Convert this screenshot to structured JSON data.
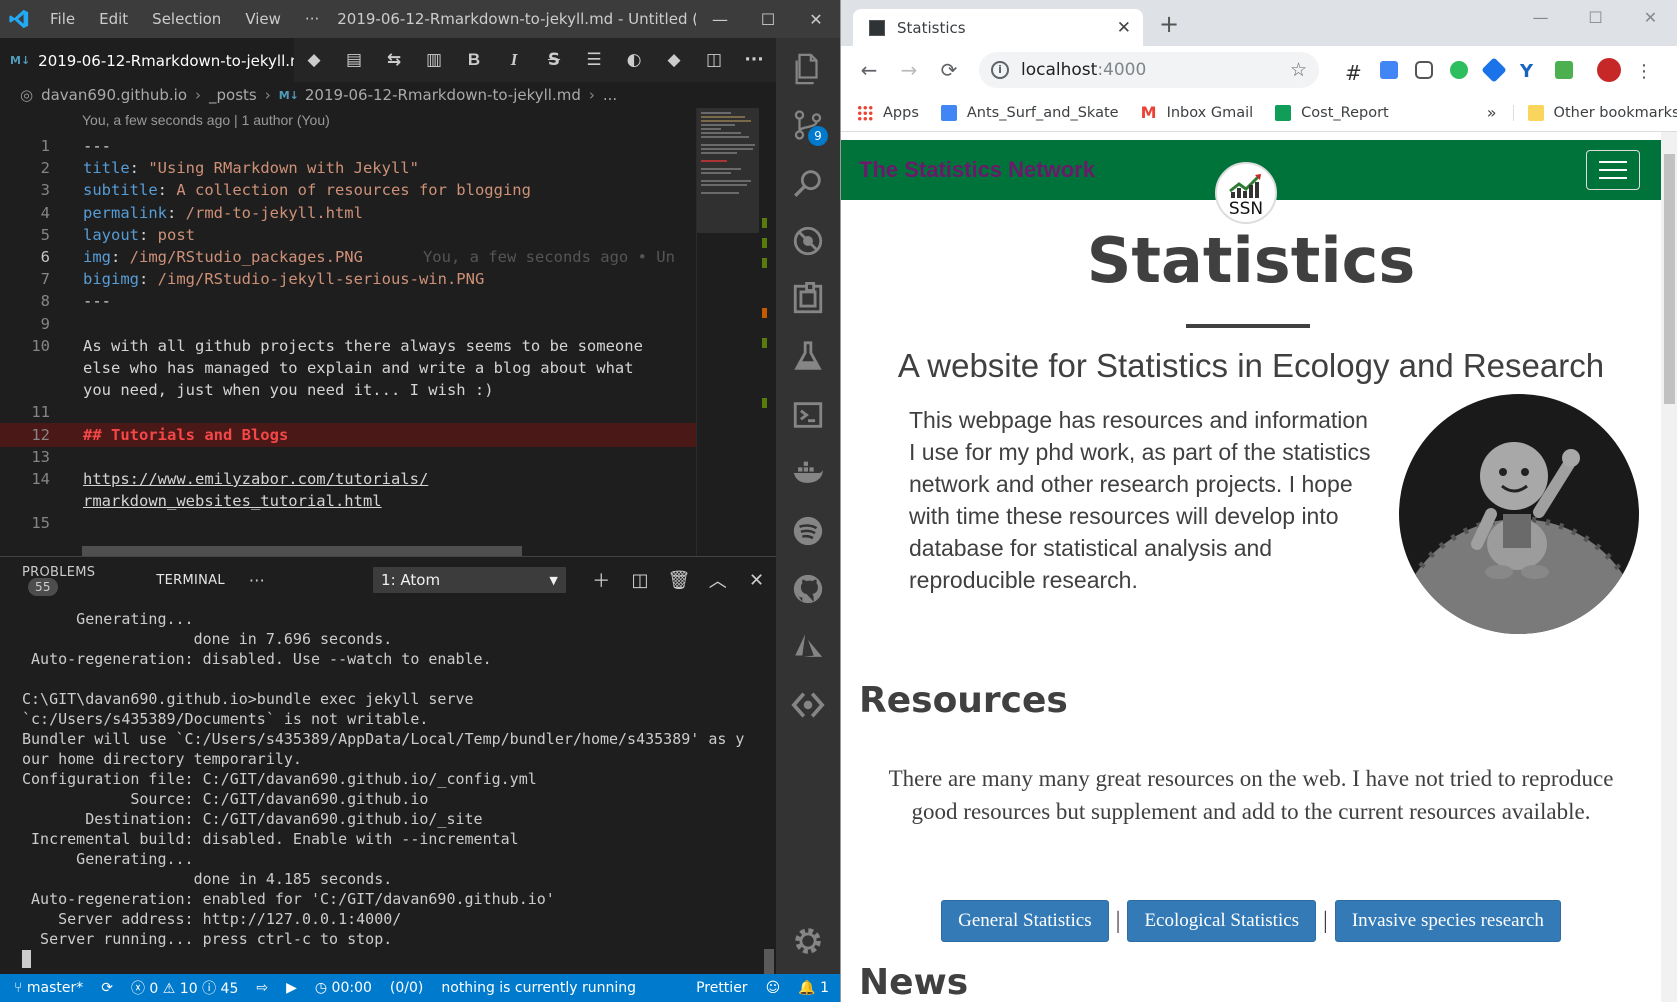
{
  "vscode": {
    "menu": [
      "File",
      "Edit",
      "Selection",
      "View",
      "···"
    ],
    "window_title": "2019-06-12-Rmarkdown-to-jekyll.md - Untitled (...",
    "tab": {
      "badge": "M↓",
      "label": "2019-06-12-Rmarkdown-to-jekyll.m"
    },
    "breadcrumb": [
      "davan690.github.io",
      "_posts",
      "2019-06-12-Rmarkdown-to-jekyll.md",
      "..."
    ],
    "codelens": "You, a few seconds ago | 1 author (You)",
    "blame": "You, a few seconds ago • Un",
    "lines": [
      {
        "n": "1",
        "parts": [
          {
            "c": "t",
            "v": "---"
          }
        ]
      },
      {
        "n": "2",
        "parts": [
          {
            "c": "k",
            "v": "title"
          },
          {
            "c": "t",
            "v": ": "
          },
          {
            "c": "s",
            "v": "\"Using RMarkdown with Jekyll\""
          }
        ]
      },
      {
        "n": "3",
        "parts": [
          {
            "c": "k",
            "v": "subtitle"
          },
          {
            "c": "t",
            "v": ": "
          },
          {
            "c": "s",
            "v": "A collection of resources for blogging"
          }
        ]
      },
      {
        "n": "4",
        "parts": [
          {
            "c": "k",
            "v": "permalink"
          },
          {
            "c": "t",
            "v": ": "
          },
          {
            "c": "s",
            "v": "/rmd-to-jekyll.html"
          }
        ]
      },
      {
        "n": "5",
        "parts": [
          {
            "c": "k",
            "v": "layout"
          },
          {
            "c": "t",
            "v": ": "
          },
          {
            "c": "s",
            "v": "post"
          }
        ]
      },
      {
        "n": "6",
        "parts": [
          {
            "c": "k",
            "v": "img"
          },
          {
            "c": "t",
            "v": ": "
          },
          {
            "c": "s",
            "v": "/img/RStudio_packages.PNG"
          }
        ]
      },
      {
        "n": "7",
        "parts": [
          {
            "c": "k",
            "v": "bigimg"
          },
          {
            "c": "t",
            "v": ": "
          },
          {
            "c": "s",
            "v": "/img/RStudio-jekyll-serious-win.PNG"
          }
        ]
      },
      {
        "n": "8",
        "parts": [
          {
            "c": "t",
            "v": "---"
          }
        ]
      },
      {
        "n": "9",
        "parts": []
      },
      {
        "n": "10",
        "parts": [
          {
            "c": "t",
            "v": "As with all github projects there always seems to be someone"
          }
        ]
      },
      {
        "n": "",
        "parts": [
          {
            "c": "t",
            "v": "else who has managed to explain and write a blog about what"
          }
        ]
      },
      {
        "n": "",
        "parts": [
          {
            "c": "t",
            "v": "you need, just when you need it... I wish :)"
          }
        ]
      },
      {
        "n": "11",
        "parts": []
      },
      {
        "n": "12",
        "parts": [
          {
            "c": "h",
            "v": "## Tutorials and Blogs"
          }
        ]
      },
      {
        "n": "13",
        "parts": []
      },
      {
        "n": "14",
        "parts": [
          {
            "c": "lnk",
            "v": "https://www.emilyzabor.com/tutorials/"
          }
        ]
      },
      {
        "n": "",
        "parts": [
          {
            "c": "lnk",
            "v": "rmarkdown_websites_tutorial.html"
          }
        ]
      },
      {
        "n": "15",
        "parts": []
      }
    ],
    "panel": {
      "problems_label": "PROBLEMS",
      "problems_count": "55",
      "terminal_label": "TERMINAL",
      "more": "···",
      "terminal_select": "1: Atom",
      "terminal_lines": [
        "      Generating...",
        "                   done in 7.696 seconds.",
        " Auto-regeneration: disabled. Use --watch to enable.",
        "",
        "C:\\GIT\\davan690.github.io>bundle exec jekyll serve",
        "`c:/Users/s435389/Documents` is not writable.",
        "Bundler will use `C:/Users/s435389/AppData/Local/Temp/bundler/home/s435389' as y",
        "our home directory temporarily.",
        "Configuration file: C:/GIT/davan690.github.io/_config.yml",
        "            Source: C:/GIT/davan690.github.io",
        "       Destination: C:/GIT/davan690.github.io/_site",
        " Incremental build: disabled. Enable with --incremental",
        "      Generating...",
        "                   done in 4.185 seconds.",
        " Auto-regeneration: enabled for 'C:/GIT/davan690.github.io'",
        "    Server address: http://127.0.0.1:4000/",
        "  Server running... press ctrl-c to stop."
      ]
    },
    "scm_badge": "9",
    "status": {
      "branch": "master*",
      "errors": "0",
      "warnings": "10",
      "info": "45",
      "timer": "00:00",
      "tasks": "(0/0)",
      "running": "nothing is currently running",
      "formatter": "Prettier",
      "bell_count": "1"
    }
  },
  "chrome": {
    "tab_title": "Statistics",
    "url_host": "localhost",
    "url_port": ":4000",
    "bookmarks": [
      "Apps",
      "Ants_Surf_and_Skate",
      "Inbox Gmail",
      "Cost_Report"
    ],
    "bookmarks_more": "»",
    "other_bookmarks": "Other bookmarks"
  },
  "site": {
    "brand": "The Statistics Network",
    "avatar_text": "SSN",
    "title": "Statistics",
    "subtitle": "A website for Statistics in Ecology and Research",
    "intro": "This webpage has resources and information I use for my phd work, as part of the statistics network and other research projects. I hope with time these resources will develop into database for statistical analysis and reproducible research.",
    "resources_heading": "Resources",
    "resources_text": "There are many many great resources on the web. I have not tried to reproduce good resources but supplement and add to the current resources available.",
    "buttons": [
      "General Statistics",
      "Ecological Statistics",
      "Invasive species research"
    ],
    "separator": "|",
    "news_heading": "News"
  },
  "colors": {
    "nav_green": "#00733b",
    "brand_purple": "#6b1a6b",
    "button_blue": "#337ab7",
    "vscode_blue": "#007acc"
  }
}
